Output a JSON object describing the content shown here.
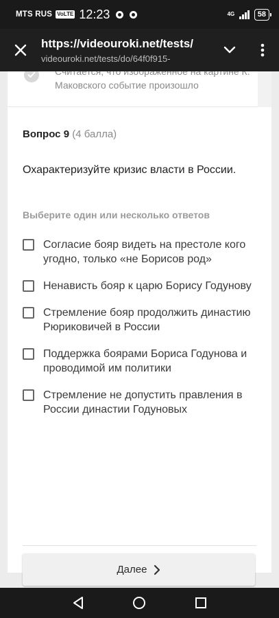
{
  "status_bar": {
    "carrier": "MTS RUS",
    "volte_badge": "VoLTE",
    "time": "12:23",
    "network_type": "4G",
    "battery": "58"
  },
  "browser": {
    "page_title": "https://videouroki.net/tests/",
    "url": "videouroki.net/tests/do/64f0f915-"
  },
  "previous_question": {
    "answer_text": "Считается, что изображенное на картине К. Маковского событие произошло"
  },
  "question": {
    "number_label": "Вопрос 9",
    "points_label": "(4 балла)",
    "text": "Охарактеризуйте кризис власти в России.",
    "instruction": "Выберите один или несколько ответов",
    "options": [
      {
        "label": "Согласие бояр видеть на престоле кого угодно, только «не Борисов род»"
      },
      {
        "label": "Ненависть бояр к царю Борису Годунову"
      },
      {
        "label": "Стремление бояр продолжить династию Рюриковичей в России"
      },
      {
        "label": "Поддержка боярами Бориса Годунова и проводимой им политики"
      },
      {
        "label": "Стремление не допустить правления в России династии Годуновых"
      }
    ]
  },
  "next_button": {
    "label": "Далее"
  },
  "icons": {
    "close": "close-icon",
    "dropdown": "chevron-down-icon",
    "menu": "more-vert-icon",
    "next": "chevron-right-icon",
    "back": "nav-back-icon",
    "home": "nav-home-icon",
    "recents": "nav-recents-icon"
  }
}
